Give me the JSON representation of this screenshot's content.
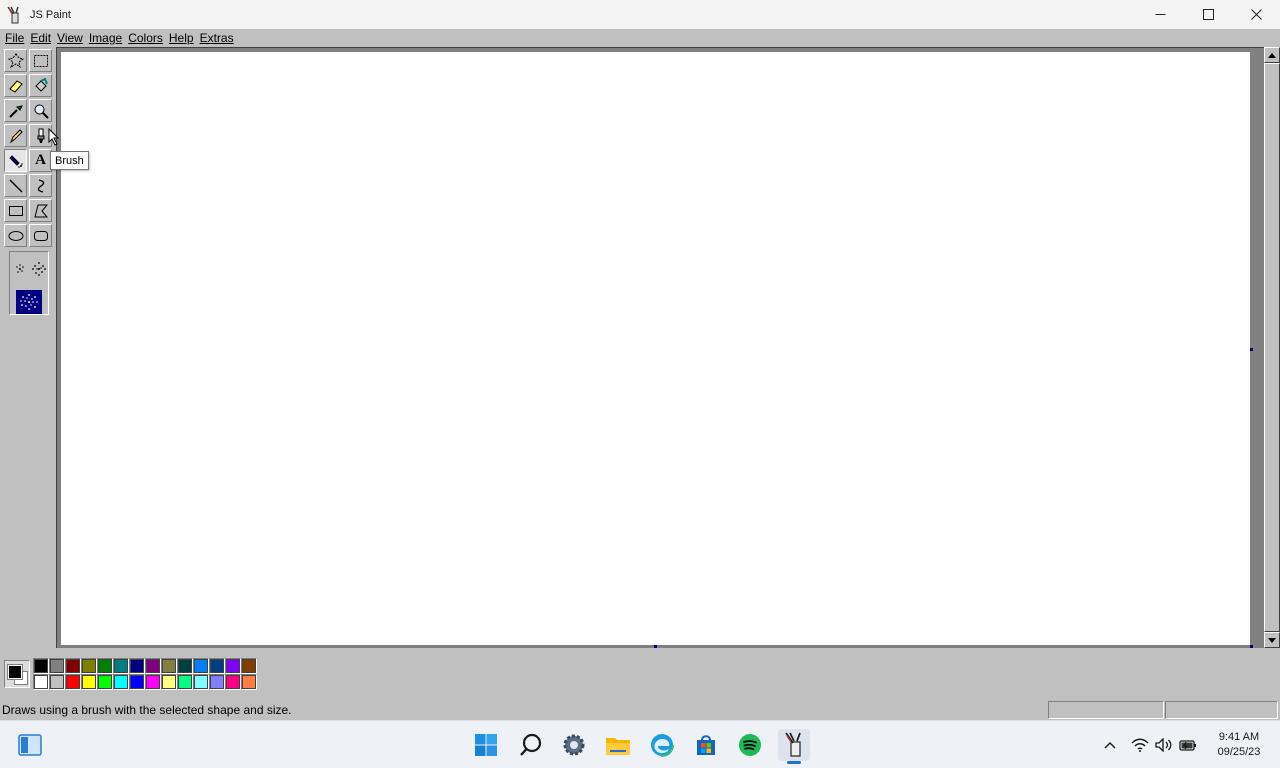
{
  "window": {
    "title": "JS Paint"
  },
  "menu": [
    "File",
    "Edit",
    "View",
    "Image",
    "Colors",
    "Help",
    "Extras"
  ],
  "tools": [
    {
      "name": "free-form-select",
      "icon": "free-form-select-icon"
    },
    {
      "name": "select",
      "icon": "rect-select-icon"
    },
    {
      "name": "eraser",
      "icon": "eraser-icon"
    },
    {
      "name": "fill-with-color",
      "icon": "fill-bucket-icon"
    },
    {
      "name": "pick-color",
      "icon": "eyedropper-icon"
    },
    {
      "name": "magnifier",
      "icon": "magnifier-icon"
    },
    {
      "name": "pencil",
      "icon": "pencil-icon"
    },
    {
      "name": "brush",
      "icon": "brush-icon"
    },
    {
      "name": "airbrush",
      "icon": "airbrush-icon",
      "selected": true
    },
    {
      "name": "text",
      "icon": "text-icon"
    },
    {
      "name": "line",
      "icon": "line-icon"
    },
    {
      "name": "curve",
      "icon": "curve-icon"
    },
    {
      "name": "rectangle",
      "icon": "rectangle-icon"
    },
    {
      "name": "polygon",
      "icon": "polygon-icon"
    },
    {
      "name": "ellipse",
      "icon": "ellipse-icon"
    },
    {
      "name": "rounded-rectangle",
      "icon": "rounded-rectangle-icon"
    }
  ],
  "tooltip": "Brush",
  "text_tool_glyph": "A",
  "colors": {
    "foreground": "#000000",
    "background": "#ffffff",
    "palette_top": [
      "#000000",
      "#808080",
      "#800000",
      "#808000",
      "#008000",
      "#008080",
      "#000080",
      "#800080",
      "#808040",
      "#004040",
      "#0080ff",
      "#004080",
      "#8000ff",
      "#804000"
    ],
    "palette_bottom": [
      "#ffffff",
      "#c0c0c0",
      "#ff0000",
      "#ffff00",
      "#00ff00",
      "#00ffff",
      "#0000ff",
      "#ff00ff",
      "#ffff80",
      "#00ff80",
      "#80ffff",
      "#8080ff",
      "#ff0080",
      "#ff8040"
    ]
  },
  "status": {
    "text": "Draws using a brush with the selected shape and size."
  },
  "taskbar": {
    "apps": [
      "start-icon",
      "search-icon",
      "settings-icon",
      "file-explorer-icon",
      "edge-icon",
      "store-icon",
      "spotify-icon",
      "jspaint-icon"
    ],
    "time": "9:41 AM",
    "date": "09/25/23"
  }
}
